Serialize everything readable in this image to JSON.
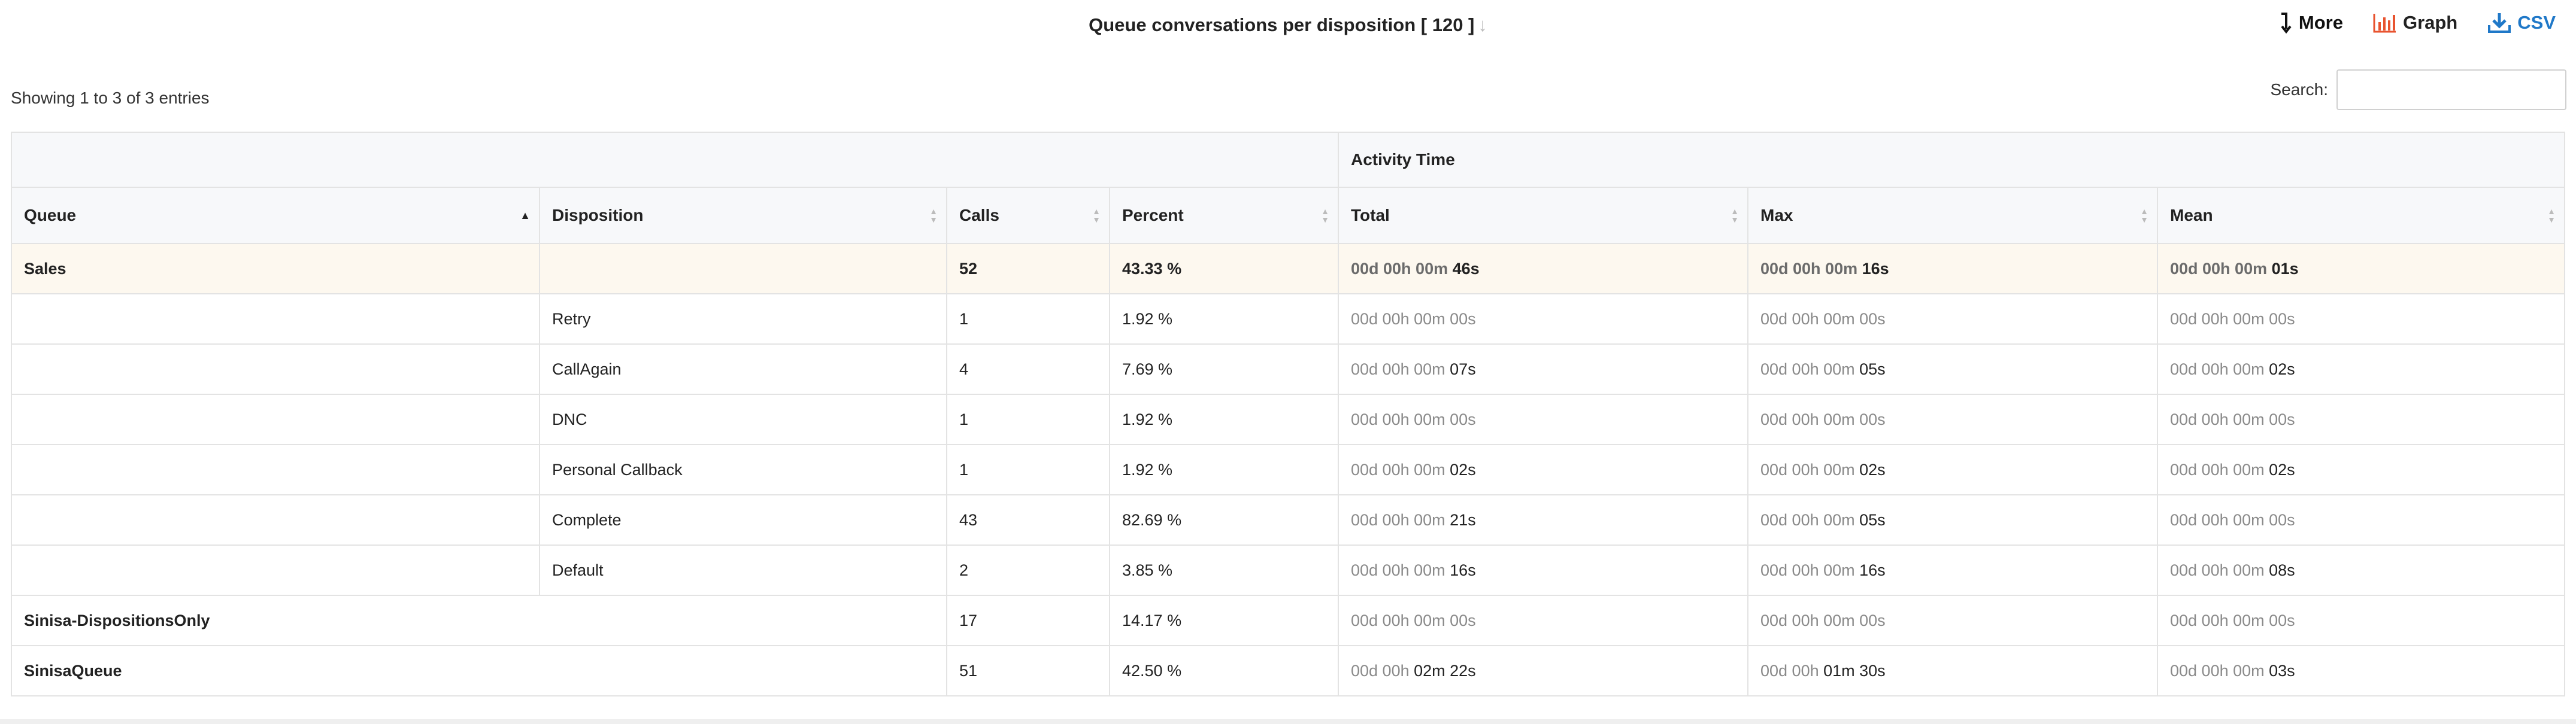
{
  "report": {
    "title": "Queue conversations per disposition [ 120 ]",
    "actions": {
      "more": "More",
      "graph": "Graph",
      "csv": "CSV"
    },
    "showing": "Showing 1 to 3 of 3 entries",
    "search_label": "Search:",
    "search_value": ""
  },
  "colors": {
    "csv": "#1f78c8",
    "graph_icon": "#e8532f",
    "highlight_row": "#fdf8ef"
  },
  "table": {
    "group_header": "Activity Time",
    "columns": [
      "Queue",
      "Disposition",
      "Calls",
      "Percent",
      "Total",
      "Max",
      "Mean"
    ],
    "rows": [
      {
        "queue": "Sales",
        "disposition": "",
        "calls": "52",
        "percent": "43.33 %",
        "total_pre": "00d 00h 00m ",
        "total_val": "46s",
        "max_pre": "00d 00h 00m ",
        "max_val": "16s",
        "mean_pre": "00d 00h 00m ",
        "mean_val": "01s"
      },
      {
        "queue": "",
        "disposition": "Retry",
        "calls": "1",
        "percent": "1.92 %",
        "total_pre": "00d 00h 00m 00s",
        "total_val": "",
        "max_pre": "00d 00h 00m 00s",
        "max_val": "",
        "mean_pre": "00d 00h 00m 00s",
        "mean_val": ""
      },
      {
        "queue": "",
        "disposition": "CallAgain",
        "calls": "4",
        "percent": "7.69 %",
        "total_pre": "00d 00h 00m ",
        "total_val": "07s",
        "max_pre": "00d 00h 00m ",
        "max_val": "05s",
        "mean_pre": "00d 00h 00m ",
        "mean_val": "02s"
      },
      {
        "queue": "",
        "disposition": "DNC",
        "calls": "1",
        "percent": "1.92 %",
        "total_pre": "00d 00h 00m 00s",
        "total_val": "",
        "max_pre": "00d 00h 00m 00s",
        "max_val": "",
        "mean_pre": "00d 00h 00m 00s",
        "mean_val": ""
      },
      {
        "queue": "",
        "disposition": "Personal Callback",
        "calls": "1",
        "percent": "1.92 %",
        "total_pre": "00d 00h 00m ",
        "total_val": "02s",
        "max_pre": "00d 00h 00m ",
        "max_val": "02s",
        "mean_pre": "00d 00h 00m ",
        "mean_val": "02s"
      },
      {
        "queue": "",
        "disposition": "Complete",
        "calls": "43",
        "percent": "82.69 %",
        "total_pre": "00d 00h 00m ",
        "total_val": "21s",
        "max_pre": "00d 00h 00m ",
        "max_val": "05s",
        "mean_pre": "00d 00h 00m 00s",
        "mean_val": ""
      },
      {
        "queue": "",
        "disposition": "Default",
        "calls": "2",
        "percent": "3.85 %",
        "total_pre": "00d 00h 00m ",
        "total_val": "16s",
        "max_pre": "00d 00h 00m ",
        "max_val": "16s",
        "mean_pre": "00d 00h 00m ",
        "mean_val": "08s"
      },
      {
        "queue": "Sinisa-DispositionsOnly",
        "disposition": "",
        "calls": "17",
        "percent": "14.17 %",
        "total_pre": "00d 00h 00m 00s",
        "total_val": "",
        "max_pre": "00d 00h 00m 00s",
        "max_val": "",
        "mean_pre": "00d 00h 00m 00s",
        "mean_val": ""
      },
      {
        "queue": "SinisaQueue",
        "disposition": "",
        "calls": "51",
        "percent": "42.50 %",
        "total_pre": "00d 00h ",
        "total_val": "02m 22s",
        "max_pre": "00d 00h ",
        "max_val": "01m 30s",
        "mean_pre": "00d 00h 00m ",
        "mean_val": "03s"
      }
    ]
  }
}
